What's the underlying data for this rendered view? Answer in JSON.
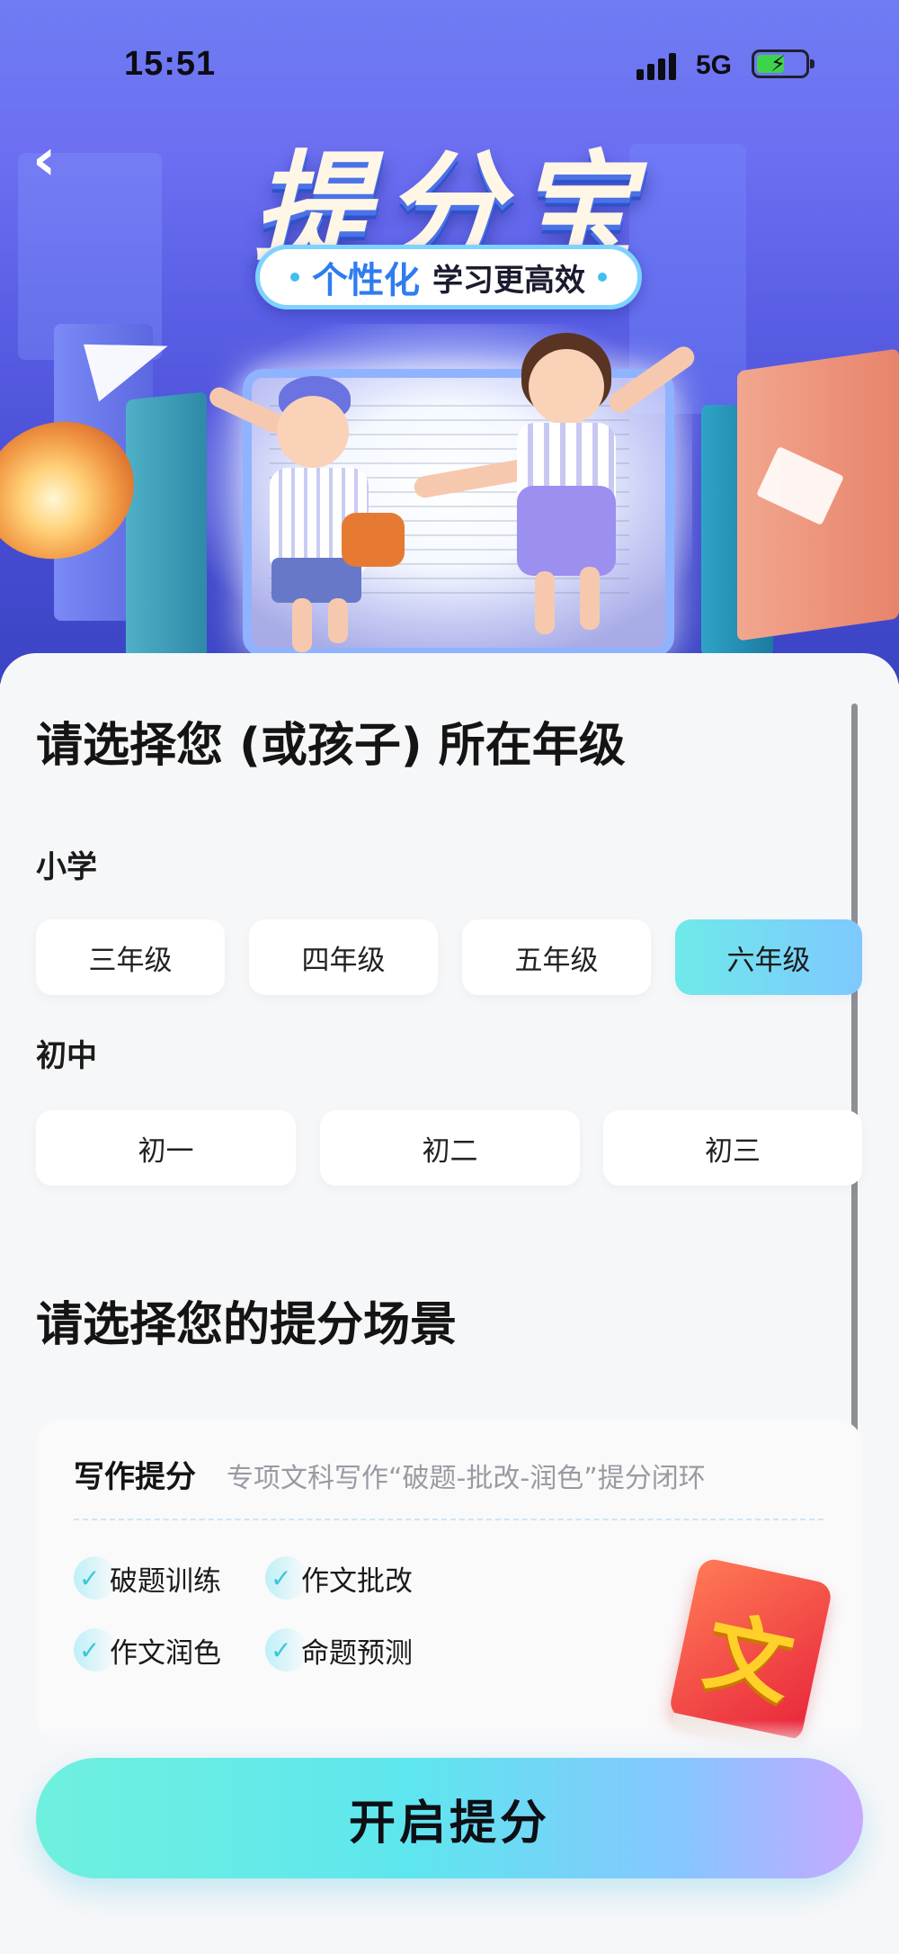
{
  "status_bar": {
    "time": "15:51",
    "network": "5G"
  },
  "header": {
    "title": "提分宝",
    "tagline_highlight": "个性化",
    "tagline_rest": "学习更高效"
  },
  "grade_section": {
    "heading": "请选择您 (或孩子) 所在年级",
    "groups": [
      {
        "label": "小学",
        "options": [
          "三年级",
          "四年级",
          "五年级",
          "六年级"
        ],
        "selected": "六年级"
      },
      {
        "label": "初中",
        "options": [
          "初一",
          "初二",
          "初三"
        ],
        "selected": ""
      }
    ]
  },
  "scene_section": {
    "heading": "请选择您的提分场景",
    "cards": [
      {
        "title": "写作提分",
        "description": "专项文科写作“破题-批改-润色”提分闭环",
        "tags": [
          "破题训练",
          "作文批改",
          "作文润色",
          "命题预测"
        ],
        "icon_glyph": "文"
      }
    ]
  },
  "cta": {
    "label": "开启提分"
  },
  "icons": [
    "back-icon",
    "signal-icon",
    "battery-icon",
    "check-icon",
    "book-icon"
  ],
  "colors": {
    "accent_start": "#6ff0de",
    "accent_end": "#c6a8ff",
    "selected_chip": "#6fe9e9"
  }
}
